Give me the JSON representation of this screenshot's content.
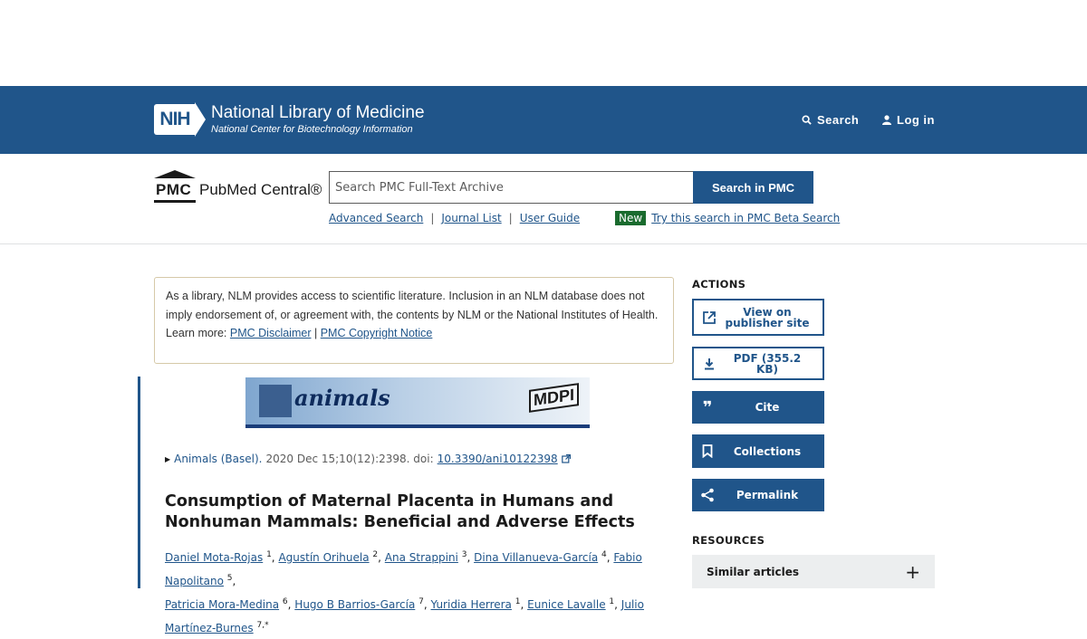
{
  "header": {
    "logo_mark": "NIH",
    "org_title": "National Library of Medicine",
    "org_subtitle": "National Center for Biotechnology Information",
    "search_label": "Search",
    "login_label": "Log in"
  },
  "pmc": {
    "logo_mark": "PMC",
    "name": "PubMed Central®",
    "search_placeholder": "Search PMC Full-Text Archive",
    "search_button": "Search in PMC",
    "links": [
      "Advanced Search",
      "Journal List",
      "User Guide"
    ],
    "new_badge": "New",
    "beta_link": "Try this search in PMC Beta Search"
  },
  "disclaimer": {
    "text": "As a library, NLM provides access to scientific literature. Inclusion in an NLM database does not imply endorsement of, or agreement with, the contents by NLM or the National Institutes of Health.",
    "learn_more": "Learn more:",
    "link1": "PMC Disclaimer",
    "divider": "|",
    "link2": "PMC Copyright Notice"
  },
  "banner": {
    "journal": "animals",
    "publisher": "MDPI"
  },
  "article": {
    "journal": "Animals (Basel).",
    "citation": "2020 Dec 15;10(12):2398. doi:",
    "doi": "10.3390/ani10122398",
    "title": "Consumption of Maternal Placenta in Humans and Nonhuman Mammals: Beneficial and Adverse Effects",
    "authors": [
      {
        "name": "Daniel Mota-Rojas",
        "sup": "1"
      },
      {
        "name": "Agustín Orihuela",
        "sup": "2"
      },
      {
        "name": "Ana Strappini",
        "sup": "3"
      },
      {
        "name": "Dina Villanueva-García",
        "sup": "4"
      },
      {
        "name": "Fabio Napolitano",
        "sup": "5"
      },
      {
        "name": "Patricia Mora-Medina",
        "sup": "6"
      },
      {
        "name": "Hugo B Barrios-García",
        "sup": "7"
      },
      {
        "name": "Yuridia Herrera",
        "sup": "1"
      },
      {
        "name": "Eunice Lavalle",
        "sup": "1"
      },
      {
        "name": "Julio Martínez-Burnes",
        "sup": "7,*"
      }
    ]
  },
  "sidebar": {
    "actions_heading": "ACTIONS",
    "view_publisher": "View on publisher site",
    "pdf": "PDF (355.2 KB)",
    "cite": "Cite",
    "collections": "Collections",
    "permalink": "Permalink",
    "resources_heading": "RESOURCES",
    "similar_articles": "Similar articles"
  },
  "colors": {
    "primary": "#20558a",
    "new_badge": "#1a6b2e"
  }
}
